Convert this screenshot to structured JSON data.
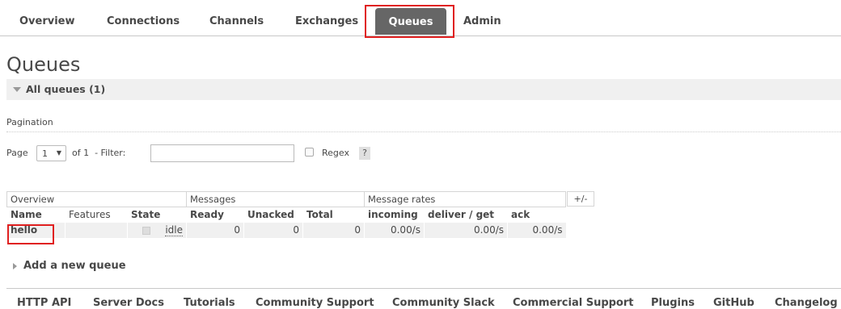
{
  "nav": {
    "tabs": [
      {
        "label": "Overview"
      },
      {
        "label": "Connections"
      },
      {
        "label": "Channels"
      },
      {
        "label": "Exchanges"
      },
      {
        "label": "Queues",
        "active": true
      },
      {
        "label": "Admin"
      }
    ]
  },
  "page_title": "Queues",
  "section": {
    "label": "All queues (1)"
  },
  "pagination": {
    "label": "Pagination",
    "page_label": "Page",
    "page_value": "1",
    "of_text": "of 1  - Filter:",
    "filter_value": "",
    "regex_label": "Regex",
    "help": "?"
  },
  "table": {
    "groups": [
      "Overview",
      "Messages",
      "Message rates"
    ],
    "toggle": "+/-",
    "columns": [
      "Name",
      "Features",
      "State",
      "Ready",
      "Unacked",
      "Total",
      "incoming",
      "deliver / get",
      "ack"
    ],
    "rows": [
      {
        "name": "hello",
        "features": "",
        "state": "idle",
        "ready": "0",
        "unacked": "0",
        "total": "0",
        "incoming": "0.00/s",
        "deliver_get": "0.00/s",
        "ack": "0.00/s"
      }
    ]
  },
  "add_queue": "Add a new queue",
  "footer": {
    "links": [
      "HTTP API",
      "Server Docs",
      "Tutorials",
      "Community Support",
      "Community Slack",
      "Commercial Support",
      "Plugins",
      "GitHub",
      "Changelog"
    ]
  },
  "colors": {
    "active_tab": "#666666",
    "highlight": "#e02020",
    "row_bg": "#f0f0f0"
  }
}
